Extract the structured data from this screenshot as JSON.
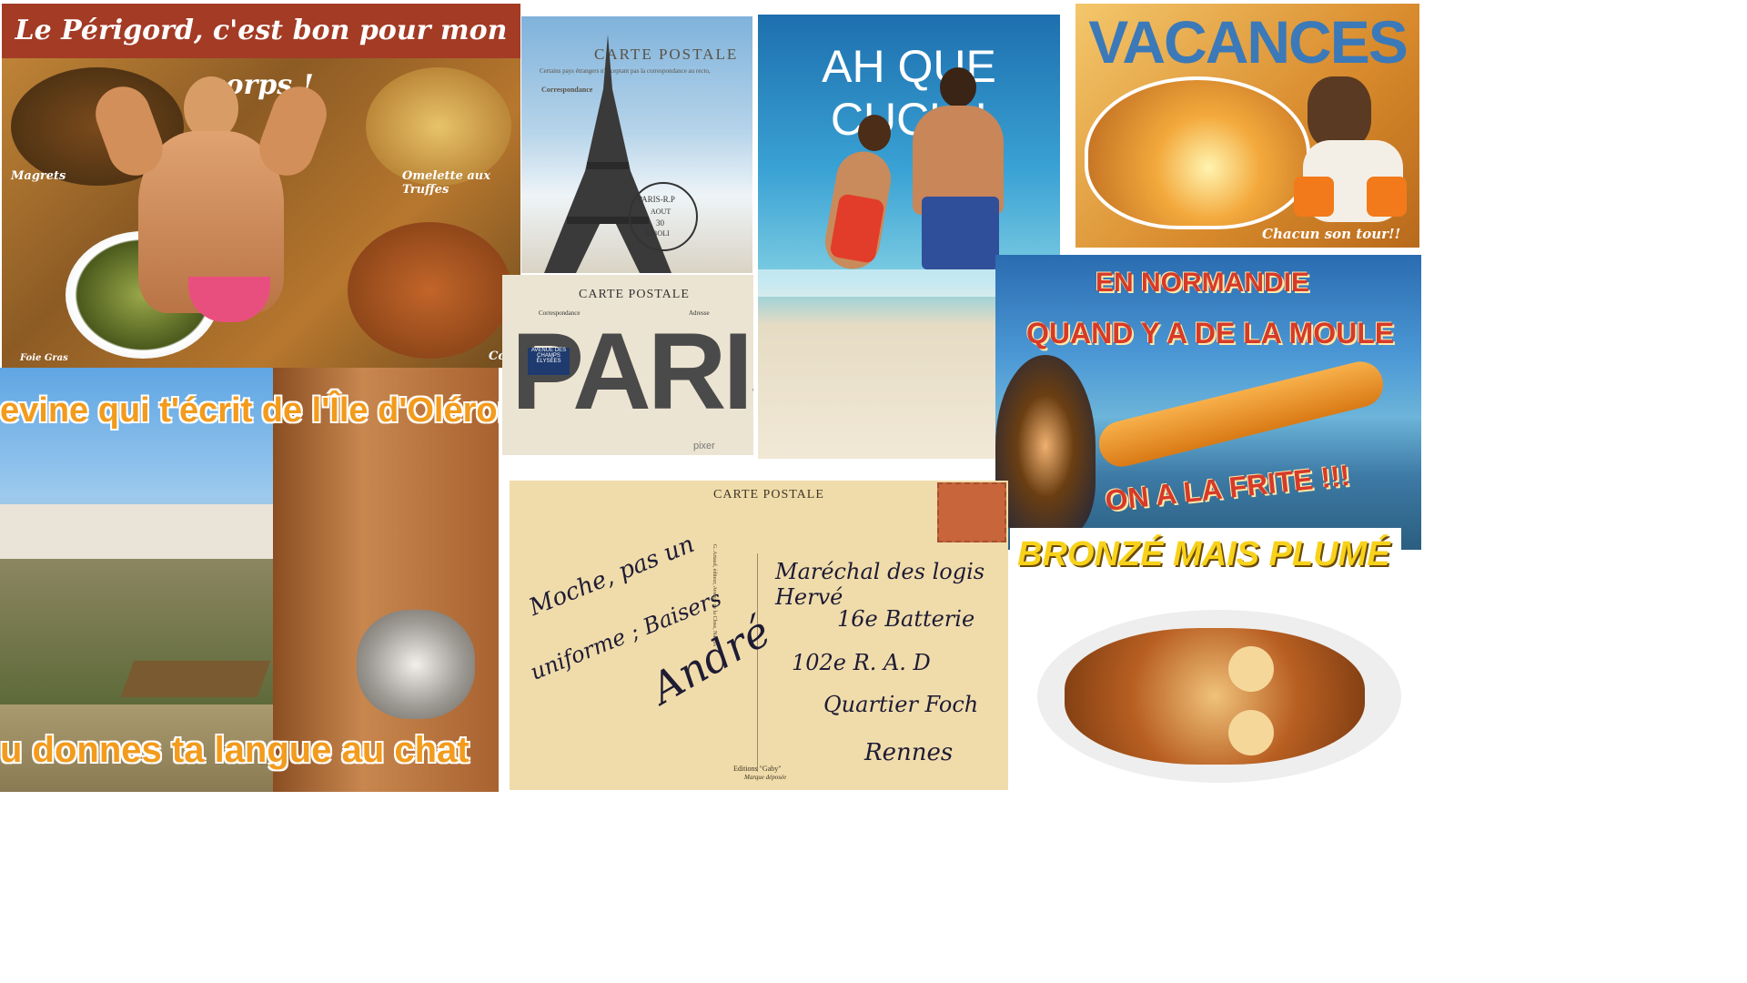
{
  "postcards": {
    "perigord": {
      "title": "Le Périgord, c'est bon pour mon corps !",
      "labels": [
        "Magrets",
        "Omelette aux Truffes",
        "Foie Gras",
        "Cou"
      ]
    },
    "eiffel": {
      "header": "CARTE POSTALE",
      "intro": "Certains pays étrangers n'acceptant pas la correspondance au recto,",
      "correspondence": "Correspondance",
      "stamp": [
        "PARIS-R.P",
        "AOUT",
        "30",
        "RIBOLI"
      ]
    },
    "cucu": {
      "title": "AH QUE CUCU !"
    },
    "vacances": {
      "title": "VACANCES",
      "caption": "Chacun son tour!!"
    },
    "paris": {
      "header": "CARTE POSTALE",
      "left_label": "Correspondance",
      "right_label": "Adresse",
      "word": "PARIS",
      "sign": "AVENUE DES CHAMPS ÉLYSÉES",
      "watermark": "pixer"
    },
    "normandie": {
      "line1": "EN NORMANDIE",
      "line2": "QUAND Y A DE LA MOULE",
      "line3": "ON A LA FRITE !!!"
    },
    "oleron": {
      "top": "evine qui t'écrit de l'Île d'Oléron",
      "bottom": "u donnes ta langue au chat"
    },
    "rennes": {
      "header": "CARTE POSTALE",
      "message": [
        "Moche, pas un",
        "uniforme ; Baisers",
        "André"
      ],
      "address": [
        "Maréchal des logis Hervé",
        "16e Batterie",
        "102e R. A. D",
        "Quartier Foch",
        "Rennes"
      ],
      "publisher": "G. Artaud, éditeur, Avenue de la Close, Nantes",
      "edition": "Editions \"Gaby\"",
      "mark": "Marque déposée"
    },
    "bronze": {
      "title": "BRONZÉ MAIS PLUMÉ"
    }
  },
  "colors": {
    "banner_red": "#a33b25",
    "oleron_orange": "#f39b1c",
    "normandie_red": "#d63a2a",
    "bronze_yellow": "#f8d21a",
    "vacances_blue": "#3b79b8"
  }
}
